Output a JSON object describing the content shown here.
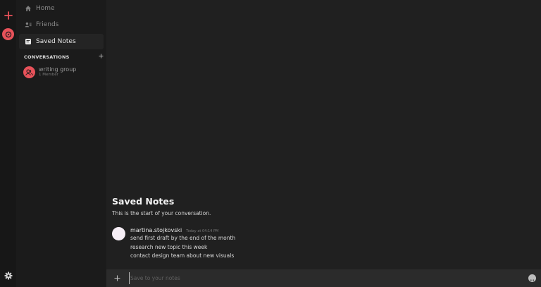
{
  "sidebar": {
    "nav": [
      {
        "label": "Home",
        "icon": "home-icon"
      },
      {
        "label": "Friends",
        "icon": "friends-icon"
      },
      {
        "label": "Saved Notes",
        "icon": "note-icon"
      }
    ],
    "conversations_header": "CONVERSATIONS",
    "conversations": [
      {
        "name": "writing group",
        "subtitle": "1 Member"
      }
    ]
  },
  "chat": {
    "title": "Saved Notes",
    "intro": "This is the start of your conversation.",
    "messages": [
      {
        "author": "martina.stojkovski",
        "time": "Today at 04:14 PM",
        "lines": [
          "send first draft by the end of the month",
          "research new topic this week",
          "contact design team about new visuals"
        ]
      }
    ]
  },
  "composer": {
    "placeholder": "Save to your notes"
  },
  "colors": {
    "accent": "#e8525a",
    "rail": "#171717",
    "sidebar": "#1b1b1b",
    "main": "#202020",
    "composer": "#2b2b2b"
  }
}
